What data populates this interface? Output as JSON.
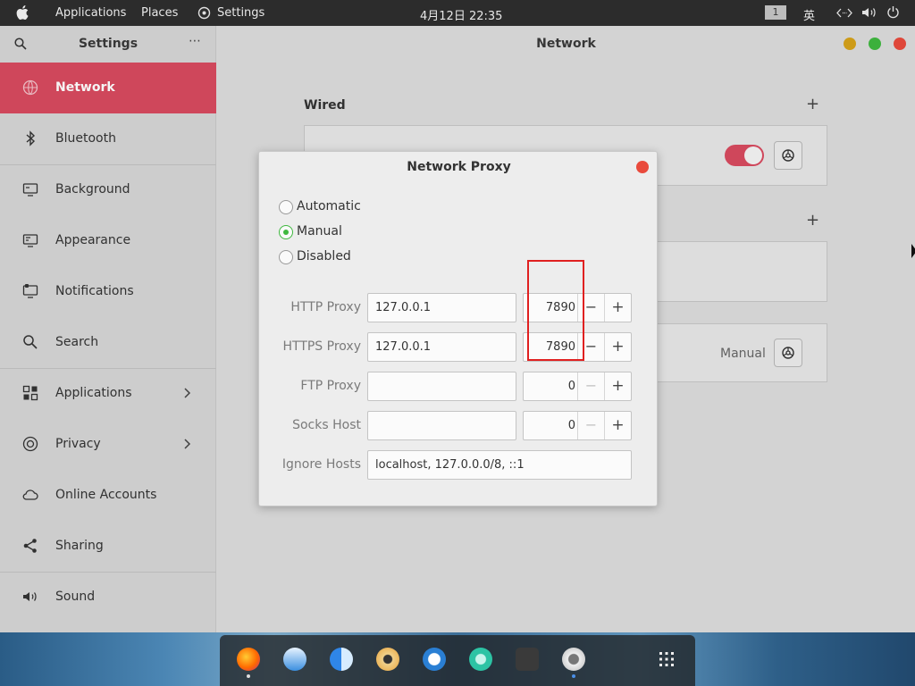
{
  "topbar": {
    "applications": "Applications",
    "places": "Places",
    "settings": "Settings",
    "datetime": "4月12日  22:35",
    "workspace": "1",
    "input_method": "英"
  },
  "sidebar": {
    "title": "Settings",
    "items": [
      {
        "label": "Network"
      },
      {
        "label": "Bluetooth"
      },
      {
        "label": "Background"
      },
      {
        "label": "Appearance"
      },
      {
        "label": "Notifications"
      },
      {
        "label": "Search"
      },
      {
        "label": "Applications"
      },
      {
        "label": "Privacy"
      },
      {
        "label": "Online Accounts"
      },
      {
        "label": "Sharing"
      },
      {
        "label": "Sound"
      }
    ]
  },
  "main": {
    "title": "Network",
    "wired_title": "Wired",
    "proxy_mode": "Manual"
  },
  "dialog": {
    "title": "Network Proxy",
    "modes": [
      "Automatic",
      "Manual",
      "Disabled"
    ],
    "selected_mode": "Manual",
    "rows": [
      {
        "label": "HTTP Proxy",
        "host": "127.0.0.1",
        "port": "7890"
      },
      {
        "label": "HTTPS Proxy",
        "host": "127.0.0.1",
        "port": "7890"
      },
      {
        "label": "FTP Proxy",
        "host": "",
        "port": "0"
      },
      {
        "label": "Socks Host",
        "host": "",
        "port": "0"
      }
    ],
    "ignore_label": "Ignore Hosts",
    "ignore_value": "localhost, 127.0.0.0/8, ::1",
    "minus": "−",
    "plus": "+"
  },
  "colors": {
    "accent": "#d84a5f",
    "radio_checked": "#3fb83f",
    "close_red": "#e94a3c",
    "annotation_box": "#e02020"
  },
  "dock": {
    "apps": [
      "firefox-icon",
      "mail-icon",
      "finder-icon",
      "media-player-icon",
      "document-viewer-icon",
      "network-app-icon",
      "terminal-icon",
      "settings-icon",
      "app-grid-icon"
    ]
  }
}
